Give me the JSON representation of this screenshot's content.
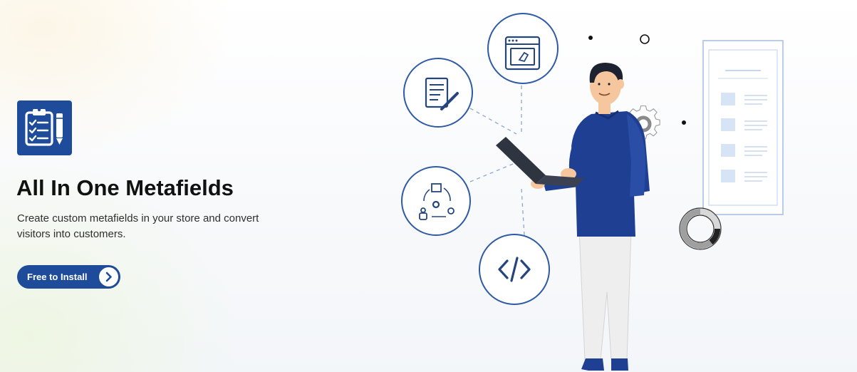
{
  "hero": {
    "title": "All In One Metafields",
    "description": "Create custom metafields in your store and convert visitors into customers.",
    "cta": {
      "label": "Free to Install",
      "icon": "chevron-right-icon"
    },
    "logo_icon": "clipboard-checklist-pencil-icon"
  },
  "illustration": {
    "icons": [
      "document-edit-icon",
      "browser-tag-icon",
      "workflow-cycle-icon",
      "code-brackets-icon",
      "gear-icon",
      "donut-chart-icon"
    ]
  },
  "colors": {
    "brand_blue": "#1e4c9a",
    "title_text": "#111111",
    "body_text": "#2f2f2f",
    "icon_circle_stroke": "#2e5aa6",
    "shirt_blue": "#1f3f93"
  }
}
